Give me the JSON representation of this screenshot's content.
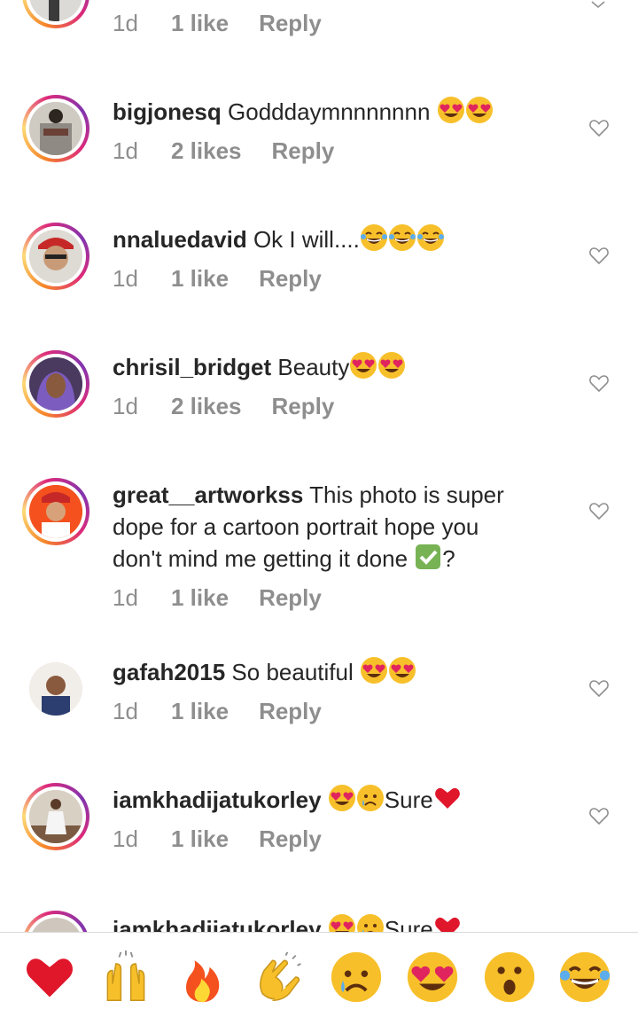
{
  "top_partial": {
    "time": "1d",
    "likes": "1 like",
    "reply": "Reply"
  },
  "comments": [
    {
      "username": "bigjonesq",
      "text": "Godddaymnnnnnnn",
      "emojis": [
        "heart-eyes",
        "heart-eyes"
      ],
      "time": "1d",
      "likes": "2 likes",
      "reply": "Reply"
    },
    {
      "username": "nnaluedavid",
      "text": "Ok I will....",
      "emojis": [
        "tears-of-joy",
        "tears-of-joy",
        "tears-of-joy"
      ],
      "time": "1d",
      "likes": "1 like",
      "reply": "Reply"
    },
    {
      "username": "chrisil_bridget",
      "text": "Beauty",
      "emojis": [
        "heart-eyes",
        "heart-eyes"
      ],
      "time": "1d",
      "likes": "2 likes",
      "reply": "Reply"
    },
    {
      "username": "great__artworkss",
      "text_line1": "This photo is super",
      "text_line2": "dope for a cartoon portrait hope you",
      "text_line3": "don't mind me getting it done",
      "text_suffix": "?",
      "emojis": [
        "check-mark"
      ],
      "time": "1d",
      "likes": "1 like",
      "reply": "Reply"
    },
    {
      "username": "gafah2015",
      "text": "So beautiful",
      "emojis": [
        "heart-eyes",
        "heart-eyes"
      ],
      "time": "1d",
      "likes": "1 like",
      "reply": "Reply"
    },
    {
      "username": "iamkhadijatukorley",
      "text": "Sure",
      "emojis": [
        "heart-eyes",
        "sad-face",
        "red-heart"
      ],
      "time": "1d",
      "likes": "1 like",
      "reply": "Reply"
    }
  ],
  "bottom_partial": {
    "username": "iamkhadijatukorley",
    "text": "Sure"
  },
  "emoji_bar": [
    {
      "name": "red-heart",
      "glyph": "❤"
    },
    {
      "name": "raising-hands",
      "glyph": "🙌"
    },
    {
      "name": "fire",
      "glyph": "🔥"
    },
    {
      "name": "clapping-hands",
      "glyph": "👏"
    },
    {
      "name": "sad-face",
      "glyph": "😢"
    },
    {
      "name": "heart-eyes",
      "glyph": "😍"
    },
    {
      "name": "surprised-face",
      "glyph": "😮"
    },
    {
      "name": "tears-of-joy",
      "glyph": "😂"
    }
  ],
  "colors": {
    "text": "#262626",
    "meta": "#8e8e8e",
    "heart_outline": "#8e8e8e"
  }
}
